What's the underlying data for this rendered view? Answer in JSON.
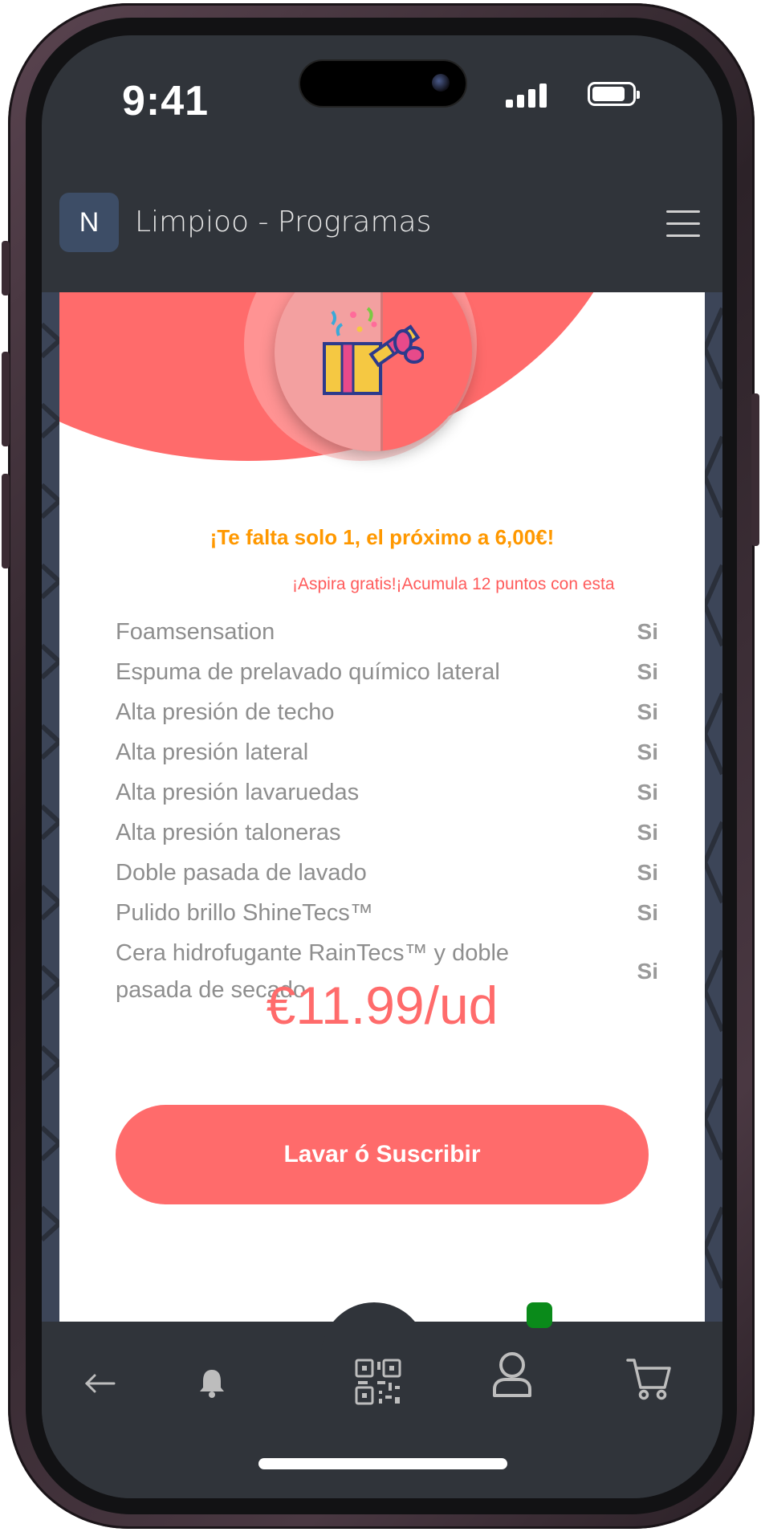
{
  "status_bar": {
    "time": "9:41"
  },
  "header": {
    "logo_letter": "N",
    "title": "Limpioo - Programas"
  },
  "promo": {
    "title": "¡Te falta solo 1, el próximo a 6,00€!",
    "marquee": "¡Aspira gratis!¡Acumula 12 puntos con esta"
  },
  "features": [
    {
      "name": "Foamsensation",
      "value": "Si"
    },
    {
      "name": "Espuma de prelavado químico lateral",
      "value": "Si"
    },
    {
      "name": "Alta presión de techo",
      "value": "Si"
    },
    {
      "name": "Alta presión lateral",
      "value": "Si"
    },
    {
      "name": "Alta presión lavaruedas",
      "value": "Si"
    },
    {
      "name": "Alta presión taloneras",
      "value": "Si"
    },
    {
      "name": "Doble pasada de lavado",
      "value": "Si"
    },
    {
      "name": "Pulido brillo ShineTecs™",
      "value": "Si"
    },
    {
      "name": "Cera hidrofugante RainTecs™ y doble pasada de secado",
      "value": "Si"
    }
  ],
  "price": "€11.99/ud",
  "cta_label": "Lavar ó Suscribir",
  "bottom_nav": [
    {
      "name": "back-arrow-icon",
      "interactable": true
    },
    {
      "name": "bell-icon",
      "interactable": true
    },
    {
      "name": "qr-code-icon",
      "interactable": true
    },
    {
      "name": "user-icon",
      "interactable": true
    },
    {
      "name": "cart-icon",
      "interactable": true
    }
  ],
  "colors": {
    "accent": "#ff6b6b",
    "promo_orange": "#ff9800",
    "dark_bg": "#30343a",
    "notification_dot": "#0a8a1a"
  }
}
